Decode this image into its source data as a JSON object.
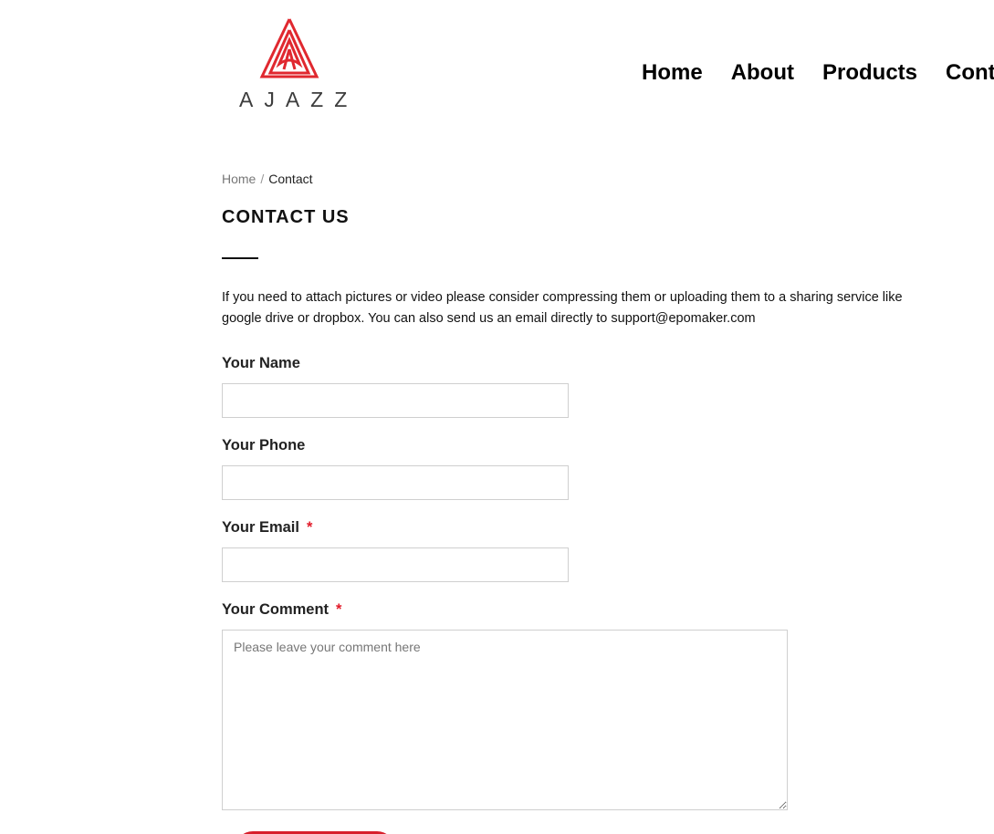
{
  "brand": {
    "name": "AJAZZ",
    "accent_color": "#e21b2a"
  },
  "nav": {
    "items": [
      {
        "label": "Home"
      },
      {
        "label": "About"
      },
      {
        "label": "Products"
      },
      {
        "label": "Cont"
      }
    ]
  },
  "breadcrumb": {
    "home": "Home",
    "separator": "/",
    "current": "Contact"
  },
  "page": {
    "title": "CONTACT US",
    "intro": "If you need to attach pictures or video please consider compressing them or uploading them to a sharing service like google drive or dropbox. You can also send us an email directly to support@epomaker.com"
  },
  "form": {
    "name": {
      "label": "Your Name",
      "value": ""
    },
    "phone": {
      "label": "Your Phone",
      "value": ""
    },
    "email": {
      "label": "Your Email",
      "required_mark": "*",
      "value": ""
    },
    "comment": {
      "label": "Your Comment",
      "required_mark": "*",
      "placeholder": "Please leave your comment here",
      "value": ""
    },
    "submit": {
      "color": "#d71f2c"
    }
  }
}
